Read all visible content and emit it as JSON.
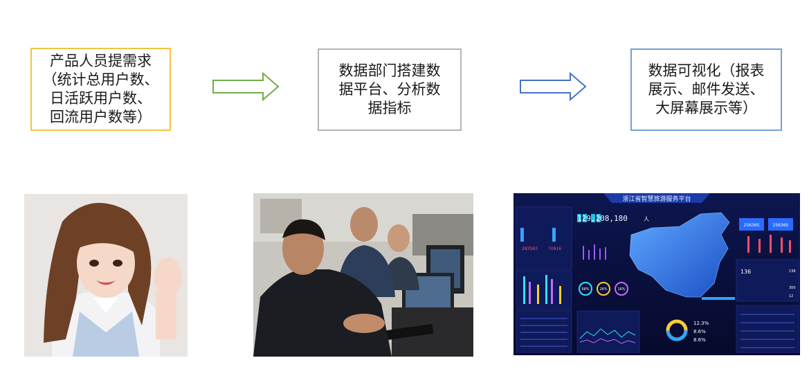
{
  "steps": [
    {
      "text": "产品人员提需求\n（统计总用户数、\n日活跃用户数、\n回流用户数等）"
    },
    {
      "text": "数据部门搭建数\n据平台、分析数\n据指标"
    },
    {
      "text": "数据可视化（报表\n展示、邮件发送、\n大屏幕展示等）"
    }
  ],
  "dashboard": {
    "title": "浙江省智慧旅游服务平台",
    "counter": "129,208,180",
    "counter_unit": "人",
    "stat_a": "256365",
    "stat_b": "256365",
    "percents": [
      "68%",
      "26%",
      "16%"
    ],
    "kpis": [
      "12.3%",
      "8.6%",
      "8.6%"
    ],
    "side_nums": [
      "136",
      "138",
      "300",
      "12"
    ],
    "red_nums": [
      "283583",
      "70916"
    ]
  },
  "colors": {
    "box1_border": "#f5c242",
    "box2_border": "#b4b4b4",
    "box3_border": "#6fa0d8",
    "arrow1": "#70ad47",
    "arrow2": "#4472c4"
  }
}
